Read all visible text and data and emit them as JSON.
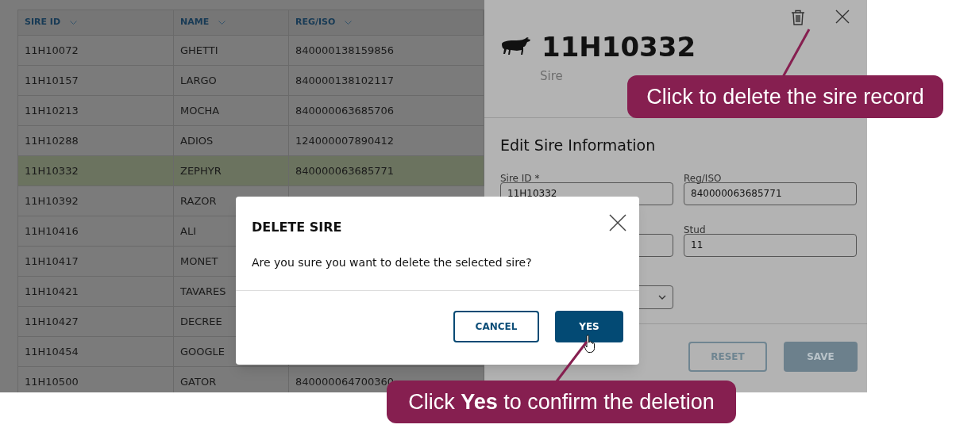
{
  "table": {
    "columns": [
      {
        "label": "SIRE ID"
      },
      {
        "label": "NAME"
      },
      {
        "label": "REG/ISO"
      }
    ],
    "rows": [
      {
        "cells": [
          "11H10072",
          "GHETTI",
          "840000138159856"
        ],
        "selected": false
      },
      {
        "cells": [
          "11H10157",
          "LARGO",
          "840000138102117"
        ],
        "selected": false
      },
      {
        "cells": [
          "11H10213",
          "MOCHA",
          "840000063685706"
        ],
        "selected": false
      },
      {
        "cells": [
          "11H10288",
          "ADIOS",
          "124000007890412"
        ],
        "selected": false
      },
      {
        "cells": [
          "11H10332",
          "ZEPHYR",
          "840000063685771"
        ],
        "selected": true
      },
      {
        "cells": [
          "11H10392",
          "RAZOR"
        ],
        "selected": false
      },
      {
        "cells": [
          "11H10416",
          "ALI"
        ],
        "selected": false
      },
      {
        "cells": [
          "11H10417",
          "MONET"
        ],
        "selected": false
      },
      {
        "cells": [
          "11H10421",
          "TAVARES"
        ],
        "selected": false
      },
      {
        "cells": [
          "11H10427",
          "DECREE"
        ],
        "selected": false
      },
      {
        "cells": [
          "11H10454",
          "GOOGLE"
        ],
        "selected": false
      },
      {
        "cells": [
          "11H10500",
          "GATOR",
          "840000064700360"
        ],
        "selected": false
      }
    ]
  },
  "detail": {
    "title": "11H10332",
    "subtitle": "Sire",
    "section_title": "Edit Sire Information",
    "fields": [
      {
        "kind": "text",
        "label": "Sire ID *",
        "value": "11H10332"
      },
      {
        "kind": "text",
        "label": "Reg/ISO",
        "value": "840000063685771"
      },
      {
        "kind": "text"
      },
      {
        "kind": "text",
        "label": "Stud",
        "value": "11"
      },
      {
        "kind": "select"
      }
    ],
    "buttons": [
      {
        "label": "RESET",
        "kind": "secondary",
        "disabled": true
      },
      {
        "label": "SAVE",
        "kind": "primary",
        "disabled": true
      }
    ]
  },
  "dialog": {
    "title": "DELETE SIRE",
    "message": "Are you sure you want to delete the selected sire?",
    "buttons": [
      {
        "label": "CANCEL",
        "kind": "secondary"
      },
      {
        "label": "YES",
        "kind": "primary"
      }
    ]
  },
  "callouts": [
    {
      "text": "Click to delete the sire record"
    },
    {
      "text": "Click **Yes** to confirm the deletion"
    }
  ]
}
